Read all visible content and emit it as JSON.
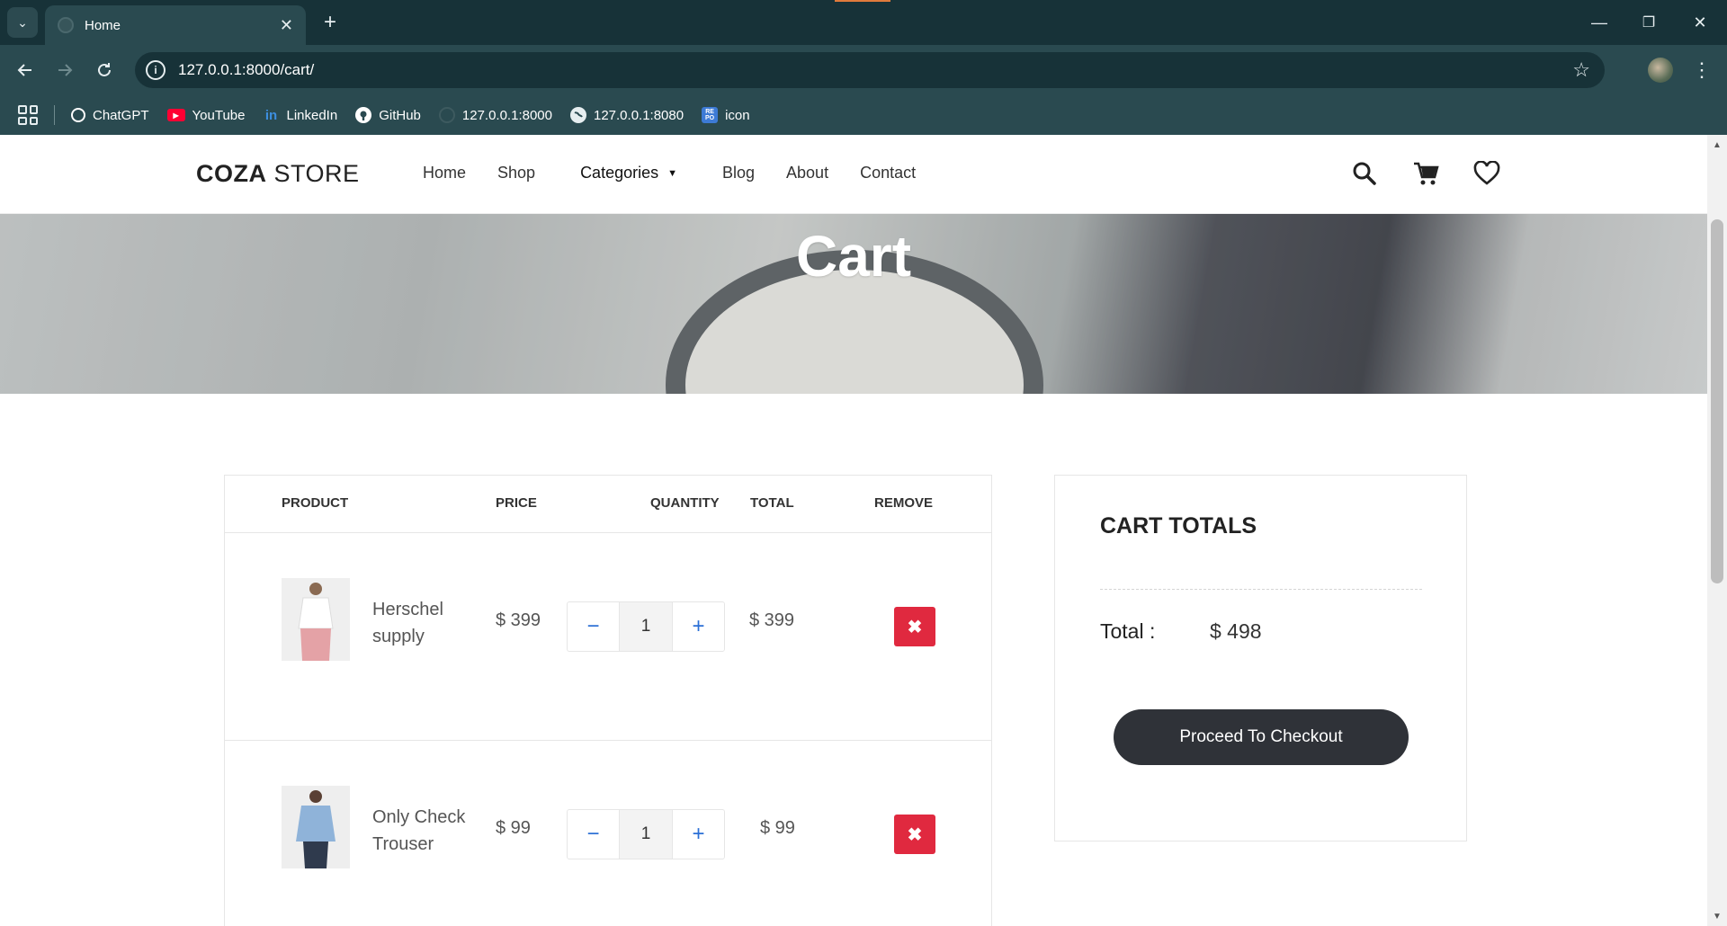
{
  "browser": {
    "tab_title": "Home",
    "tab_close": "✕",
    "new_tab": "+",
    "url": "127.0.0.1:8000/cart/",
    "site_info_glyph": "i",
    "window_minimize": "—",
    "window_restore": "❐",
    "window_close": "✕",
    "bookmarks": [
      {
        "label": "ChatGPT",
        "icon": "openai-icon",
        "color": "#ffffff"
      },
      {
        "label": "YouTube",
        "icon": "youtube-icon",
        "color": "#ff0033"
      },
      {
        "label": "LinkedIn",
        "icon": "linkedin-icon",
        "color": "#0a66c2"
      },
      {
        "label": "GitHub",
        "icon": "github-icon",
        "color": "#ffffff"
      },
      {
        "label": "127.0.0.1:8000",
        "icon": "globe-icon",
        "color": "#2a4a50"
      },
      {
        "label": "127.0.0.1:8080",
        "icon": "globe-icon",
        "color": "#e6eef0"
      },
      {
        "label": "icon",
        "icon": "bookmark-app-icon",
        "color": "#3d7bd6"
      }
    ]
  },
  "site": {
    "logo_bold": "COZA",
    "logo_light": " STORE",
    "nav": [
      "Home",
      "Shop",
      "Categories",
      "Blog",
      "About",
      "Contact"
    ],
    "hero_title": "Cart"
  },
  "cart": {
    "headers": {
      "product": "PRODUCT",
      "price": "PRICE",
      "quantity": "QUANTITY",
      "total": "TOTAL",
      "remove": "REMOVE"
    },
    "qty_minus": "−",
    "qty_plus": "+",
    "remove_glyph": "✖",
    "items": [
      {
        "name": "Herschel supply",
        "price": "$ 399",
        "quantity": "1",
        "total": "$ 399",
        "image": "shirt-white-pink-trousers"
      },
      {
        "name": "Only Check Trouser",
        "price": "$ 99",
        "quantity": "1",
        "total": "$ 99",
        "image": "shirt-blue-check"
      }
    ]
  },
  "totals": {
    "title": "CART TOTALS",
    "label": "Total :",
    "value": "$ 498",
    "checkout": "Proceed To Checkout"
  },
  "colors": {
    "chrome_dark": "#173238",
    "chrome_toolbar": "#2a4a50",
    "remove_red": "#e0293f",
    "checkout_dark": "#2f3238",
    "qty_accent": "#2b6fd6"
  }
}
